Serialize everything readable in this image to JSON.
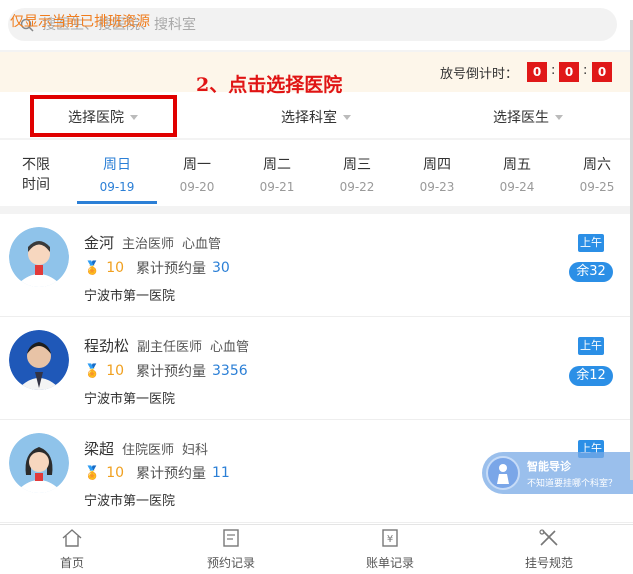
{
  "search": {
    "placeholder": "搜医生、搜医院、搜科室"
  },
  "notice": {
    "text": "仅显示当前已排班资源"
  },
  "annotation": {
    "text": "2、点击选择医院"
  },
  "countdown": {
    "label": "放号倒计时：",
    "hours": "0",
    "minutes": "0",
    "seconds": "0",
    "sep": ":"
  },
  "filters": {
    "hospital": "选择医院",
    "department": "选择科室",
    "doctor": "选择医生"
  },
  "dates": {
    "nolimit_line1": "不限",
    "nolimit_line2": "时间",
    "days": [
      {
        "weekday": "周日",
        "date": "09-19",
        "active": true
      },
      {
        "weekday": "周一",
        "date": "09-20"
      },
      {
        "weekday": "周二",
        "date": "09-21"
      },
      {
        "weekday": "周三",
        "date": "09-22"
      },
      {
        "weekday": "周四",
        "date": "09-23"
      },
      {
        "weekday": "周五",
        "date": "09-24"
      },
      {
        "weekday": "周六",
        "date": "09-25"
      }
    ]
  },
  "doctors": [
    {
      "name": "金河",
      "title": "主治医师",
      "dept": "心血管",
      "score": "10",
      "cum_label": "累计预约量",
      "cum_value": "30",
      "hospital": "宁波市第一医院",
      "period": "上午",
      "remaining": "余32"
    },
    {
      "name": "程劲松",
      "title": "副主任医师",
      "dept": "心血管",
      "score": "10",
      "cum_label": "累计预约量",
      "cum_value": "3356",
      "hospital": "宁波市第一医院",
      "period": "上午",
      "remaining": "余12"
    },
    {
      "name": "梁超",
      "title": "住院医师",
      "dept": "妇科",
      "score": "10",
      "cum_label": "累计预约量",
      "cum_value": "11",
      "hospital": "宁波市第一医院",
      "period": "上午",
      "remaining": ""
    }
  ],
  "assistant": {
    "title": "智能导诊",
    "subtitle": "不知道要挂哪个科室？"
  },
  "tabs": [
    {
      "label": "首页",
      "icon": "home-icon"
    },
    {
      "label": "预约记录",
      "icon": "appointment-icon"
    },
    {
      "label": "账单记录",
      "icon": "bill-icon"
    },
    {
      "label": "挂号规范",
      "icon": "rules-icon"
    }
  ],
  "colors": {
    "accent": "#2b7fd6",
    "countdown": "#e01818",
    "notice": "#f07c1c",
    "annotation": "#e01414"
  }
}
